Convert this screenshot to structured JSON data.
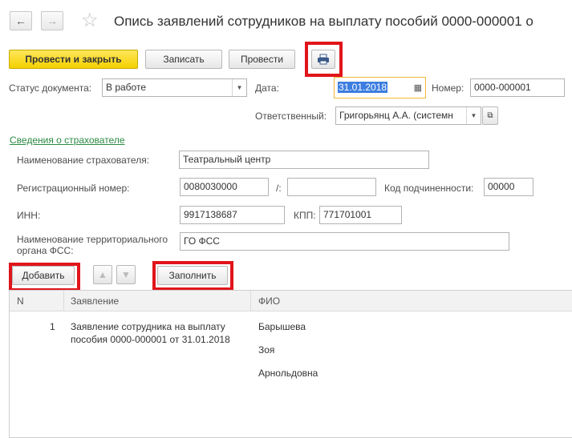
{
  "header": {
    "title": "Опись заявлений сотрудников на выплату пособий 0000-000001 о"
  },
  "toolbar": {
    "post_and_close": "Провести и закрыть",
    "save": "Записать",
    "post": "Провести"
  },
  "form": {
    "status_label": "Статус документа:",
    "status_value": "В работе",
    "date_label": "Дата:",
    "date_value": "31.01.2018",
    "number_label": "Номер:",
    "number_value": "0000-000001",
    "responsible_label": "Ответственный:",
    "responsible_value": "Григорьянц А.А. (системн"
  },
  "insurer": {
    "link": "Сведения о страхователе",
    "name_label": "Наименование страхователя:",
    "name_value": "Театральный центр",
    "reg_label": "Регистрационный номер:",
    "reg_value": "0080030000",
    "slash": "/:",
    "reg_value2": "",
    "sub_code_label": "Код подчиненности:",
    "sub_code_value": "00000",
    "inn_label": "ИНН:",
    "inn_value": "9917138687",
    "kpp_label": "КПП:",
    "kpp_value": "771701001",
    "fss_label_line1": "Наименование территориального",
    "fss_label_line2": "органа ФСС:",
    "fss_value": "ГО ФСС"
  },
  "table_toolbar": {
    "add": "Добавить",
    "fill": "Заполнить"
  },
  "table": {
    "columns": [
      "N",
      "Заявление",
      "ФИО"
    ],
    "rows": [
      {
        "n": "1",
        "statement_line1": "Заявление сотрудника на выплату",
        "statement_line2": "пособия 0000-000001 от 31.01.2018",
        "fio_line1": "Барышева",
        "fio_line2": "Зоя",
        "fio_line3": "Арнольдовна"
      }
    ]
  },
  "colors": {
    "highlight": "#e0151b",
    "primary_button": "#f5d100",
    "link": "#2a8a42"
  }
}
